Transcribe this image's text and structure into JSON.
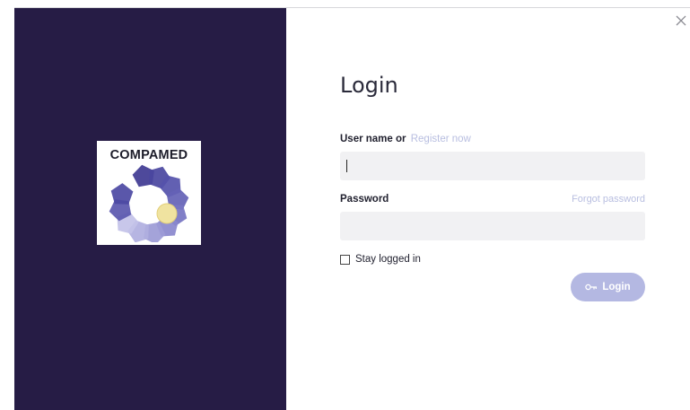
{
  "dialog": {
    "title": "Login",
    "close_icon": "close-icon",
    "brand": {
      "logo_text": "COMPAMED"
    },
    "username": {
      "label": "User name or",
      "register_link": "Register now",
      "value": "",
      "placeholder": ""
    },
    "password": {
      "label": "Password",
      "forgot_link": "Forgot password",
      "value": "",
      "placeholder": ""
    },
    "stay_logged_in": {
      "label": "Stay logged in",
      "checked": false
    },
    "login_button": {
      "label": "Login",
      "icon": "key-icon"
    }
  },
  "colors": {
    "left_panel": "#261c45",
    "accent": "#b4b8e2",
    "link": "#b8bee0",
    "input_bg": "#f1f1f3"
  }
}
